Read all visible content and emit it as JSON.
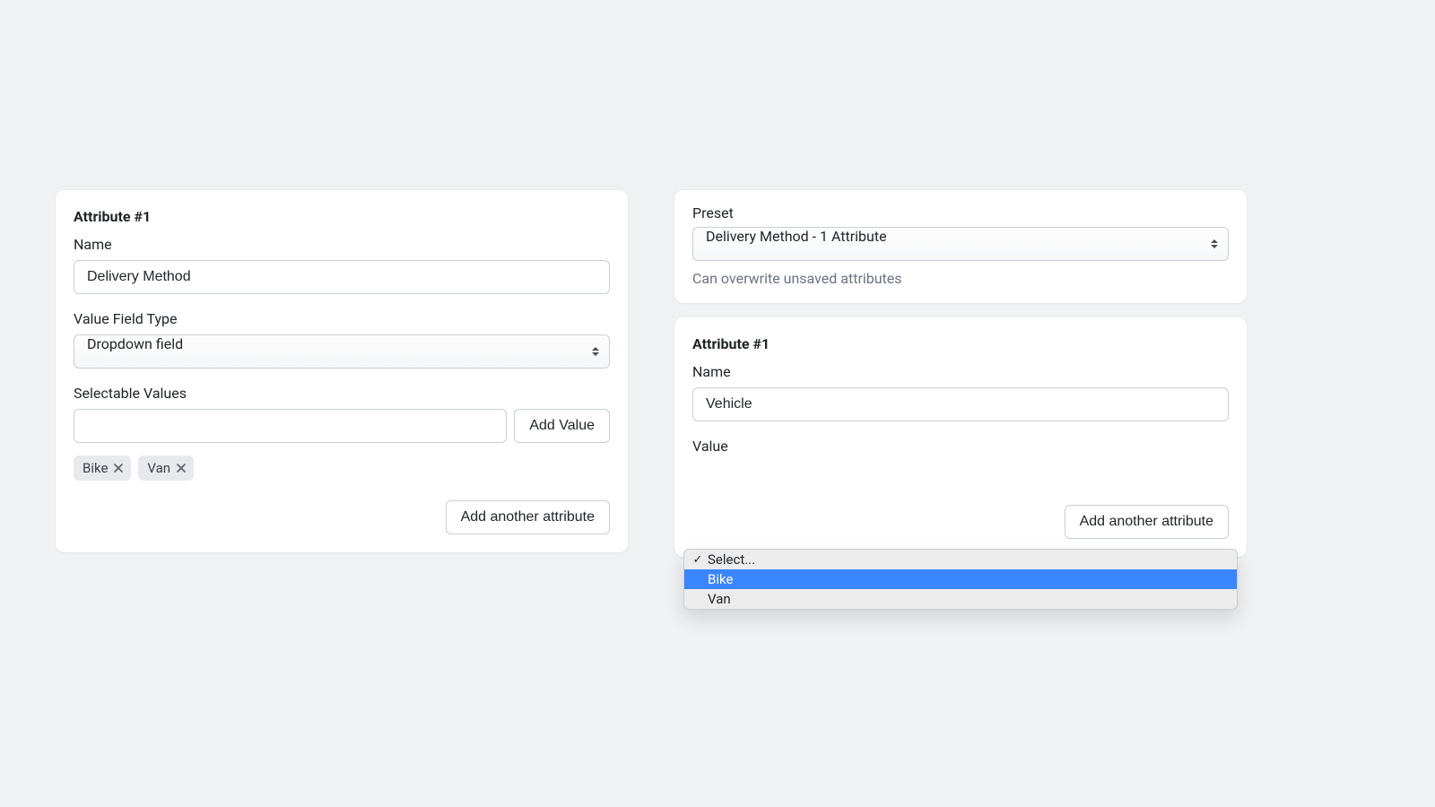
{
  "left": {
    "title": "Attribute #1",
    "name_label": "Name",
    "name_value": "Delivery Method",
    "type_label": "Value Field Type",
    "type_value": "Dropdown field",
    "values_label": "Selectable Values",
    "new_value": "",
    "add_value_btn": "Add Value",
    "tags": [
      {
        "label": "Bike"
      },
      {
        "label": "Van"
      }
    ],
    "add_attr_btn": "Add another attribute"
  },
  "right": {
    "preset_card": {
      "label": "Preset",
      "value": "Delivery Method - 1 Attribute",
      "helper": "Can overwrite unsaved attributes"
    },
    "attr_card": {
      "title": "Attribute #1",
      "name_label": "Name",
      "name_value": "Vehicle",
      "value_label": "Value",
      "dropdown": {
        "placeholder": "Select...",
        "options": [
          "Bike",
          "Van"
        ],
        "highlighted": "Bike"
      },
      "add_attr_btn": "Add another attribute"
    }
  }
}
